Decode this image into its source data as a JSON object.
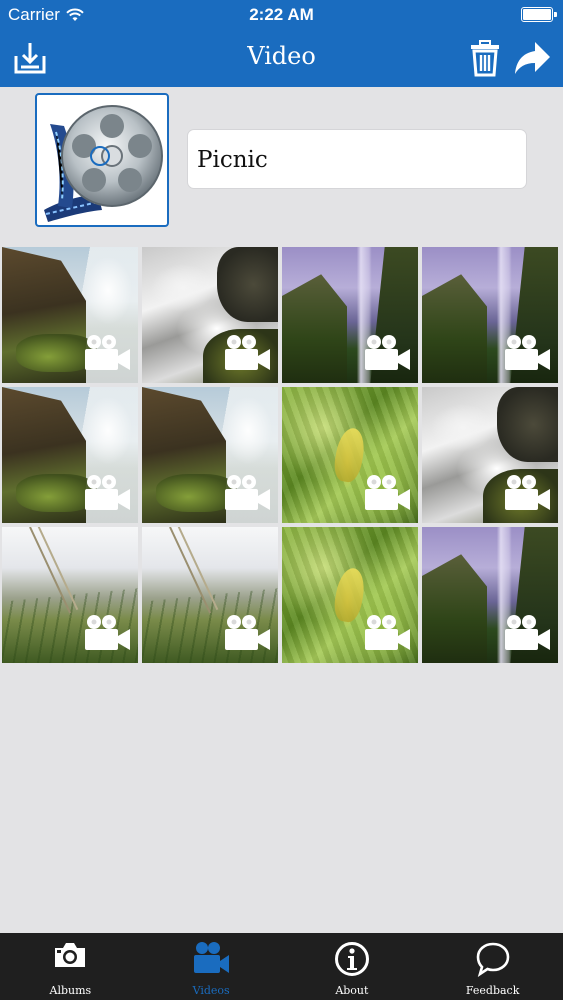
{
  "status_bar": {
    "carrier": "Carrier",
    "time": "2:22 AM"
  },
  "nav": {
    "title": "Video",
    "left_icon": "download-tray-icon",
    "right_icons": [
      "trash-icon",
      "share-arrow-icon"
    ]
  },
  "album": {
    "name": "Picnic",
    "thumbnail_icon": "film-reel-icon"
  },
  "videos": [
    {
      "scene": "fallsA",
      "badge_icon": "video-camera-icon"
    },
    {
      "scene": "stream",
      "badge_icon": "video-camera-icon"
    },
    {
      "scene": "fallsB",
      "badge_icon": "video-camera-icon"
    },
    {
      "scene": "fallsB",
      "badge_icon": "video-camera-icon"
    },
    {
      "scene": "fallsA",
      "badge_icon": "video-camera-icon"
    },
    {
      "scene": "fallsA",
      "badge_icon": "video-camera-icon"
    },
    {
      "scene": "leaves",
      "badge_icon": "video-camera-icon"
    },
    {
      "scene": "stream",
      "badge_icon": "video-camera-icon"
    },
    {
      "scene": "grass",
      "badge_icon": "video-camera-icon"
    },
    {
      "scene": "grass",
      "badge_icon": "video-camera-icon"
    },
    {
      "scene": "leaves",
      "badge_icon": "video-camera-icon"
    },
    {
      "scene": "fallsB",
      "badge_icon": "video-camera-icon"
    }
  ],
  "tabbar": {
    "tabs": [
      {
        "label": "Albums",
        "icon": "camera-icon",
        "active": false
      },
      {
        "label": "Videos",
        "icon": "video-camera-icon",
        "active": true
      },
      {
        "label": "About",
        "icon": "info-icon",
        "active": false
      },
      {
        "label": "Feedback",
        "icon": "speech-bubble-icon",
        "active": false
      }
    ]
  },
  "colors": {
    "accent": "#1a6cbf",
    "background": "#e3e3e5",
    "tabbar": "#1f1f1f"
  }
}
